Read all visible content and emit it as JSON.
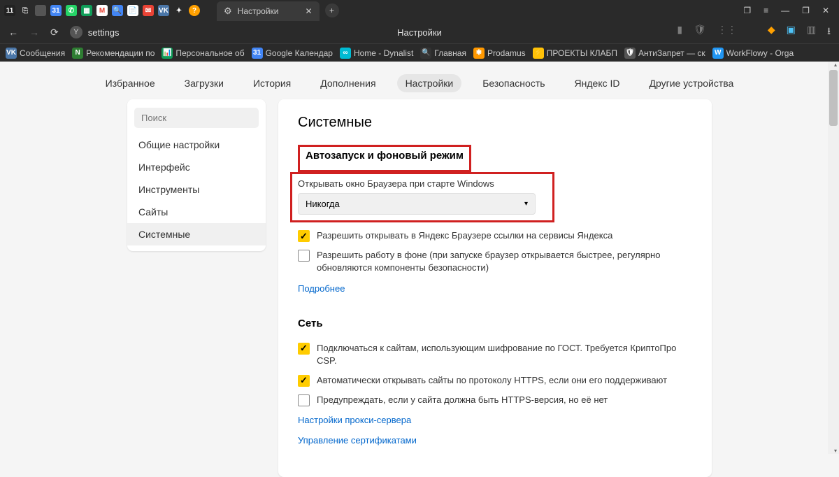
{
  "titlebar": {
    "tab_title": "Настройки",
    "top_icons": [
      "11",
      "⎘",
      "",
      "📅",
      "💬",
      "📊",
      "M",
      "🔍",
      "📄",
      "✉",
      "VK",
      "✦",
      "?"
    ]
  },
  "addressbar": {
    "url_text": "settings",
    "center_title": "Настройки"
  },
  "bookmarks": [
    {
      "icon": "VK",
      "color": "#4a76a8",
      "label": "Сообщения"
    },
    {
      "icon": "N",
      "color": "#2e7d32",
      "label": "Рекомендации по"
    },
    {
      "icon": "📊",
      "color": "#0f9d58",
      "label": "Персональное об"
    },
    {
      "icon": "31",
      "color": "#4285f4",
      "label": "Google Календар"
    },
    {
      "icon": "∞",
      "color": "#00bcd4",
      "label": "Home - Dynalist"
    },
    {
      "icon": "🔍",
      "color": "#333",
      "label": "Главная"
    },
    {
      "icon": "✱",
      "color": "#ff9800",
      "label": "Prodamus"
    },
    {
      "icon": "⚡",
      "color": "#ffc107",
      "label": "ПРОЕКТЫ КЛАБП"
    },
    {
      "icon": "🛡",
      "color": "#555",
      "label": "АнтиЗапрет — ск"
    },
    {
      "icon": "W",
      "color": "#2196f3",
      "label": "WorkFlowy - Orga"
    }
  ],
  "tabnav": [
    {
      "label": "Избранное",
      "active": false
    },
    {
      "label": "Загрузки",
      "active": false
    },
    {
      "label": "История",
      "active": false
    },
    {
      "label": "Дополнения",
      "active": false
    },
    {
      "label": "Настройки",
      "active": true
    },
    {
      "label": "Безопасность",
      "active": false
    },
    {
      "label": "Яндекс ID",
      "active": false
    },
    {
      "label": "Другие устройства",
      "active": false
    }
  ],
  "sidebar": {
    "search_placeholder": "Поиск",
    "items": [
      {
        "label": "Общие настройки",
        "active": false
      },
      {
        "label": "Интерфейс",
        "active": false
      },
      {
        "label": "Инструменты",
        "active": false
      },
      {
        "label": "Сайты",
        "active": false
      },
      {
        "label": "Системные",
        "active": true
      }
    ]
  },
  "panel": {
    "heading": "Системные",
    "autostart": {
      "title": "Автозапуск и фоновый режим",
      "desc": "Открывать окно Браузера при старте Windows",
      "select_value": "Никогда",
      "chk1": {
        "checked": true,
        "label": "Разрешить открывать в Яндекс Браузере ссылки на сервисы Яндекса"
      },
      "chk2": {
        "checked": false,
        "label": "Разрешить работу в фоне (при запуске браузер открывается быстрее, регулярно обновляются компоненты безопасности)"
      },
      "more": "Подробнее"
    },
    "network": {
      "title": "Сеть",
      "chk1": {
        "checked": true,
        "label": "Подключаться к сайтам, использующим шифрование по ГОСТ. Требуется КриптоПро CSP."
      },
      "chk2": {
        "checked": true,
        "label": "Автоматически открывать сайты по протоколу HTTPS, если они его поддерживают"
      },
      "chk3": {
        "checked": false,
        "label": "Предупреждать, если у сайта должна быть HTTPS-версия, но её нет"
      },
      "link1": "Настройки прокси-сервера",
      "link2": "Управление сертификатами"
    }
  }
}
